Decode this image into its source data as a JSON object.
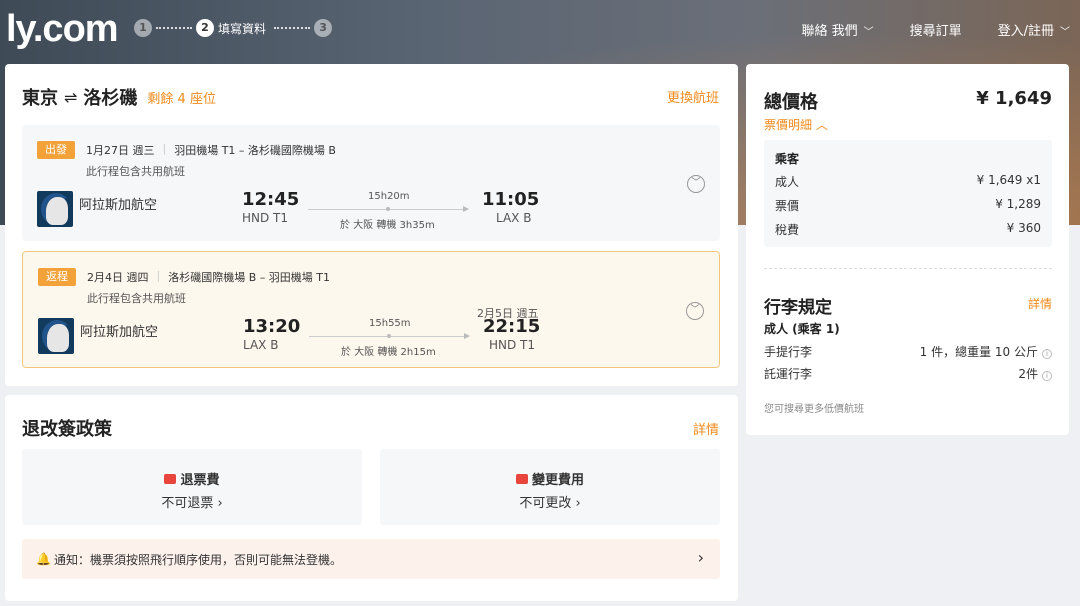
{
  "header": {
    "logo": "ly.com",
    "steps": [
      {
        "num": "1",
        "label": ""
      },
      {
        "num": "2",
        "label": "填寫資料"
      },
      {
        "num": "3",
        "label": ""
      }
    ],
    "nav": {
      "contact": "聯絡 我們",
      "search_orders": "搜尋訂單",
      "login": "登入/註冊"
    }
  },
  "flight": {
    "origin": "東京",
    "destination": "洛杉磯",
    "route_arrow": "⇌",
    "seats_left": "剩餘 4 座位",
    "change_flight": "更換航班",
    "segments": [
      {
        "badge": "出發",
        "date": "1月27日 週三",
        "route": "羽田機場 T1 – 洛杉磯國際機場 B",
        "shared": "此行程包含共用航班",
        "airline": "阿拉斯加航空",
        "dep_time": "12:45",
        "dep_code": "HND T1",
        "duration": "15h20m",
        "transfer": "於 大阪 轉機 3h35m",
        "arr_date": "",
        "arr_time": "11:05",
        "arr_code": "LAX B"
      },
      {
        "badge": "返程",
        "date": "2月4日 週四",
        "route": "洛杉磯國際機場 B – 羽田機場 T1",
        "shared": "此行程包含共用航班",
        "airline": "阿拉斯加航空",
        "dep_time": "13:20",
        "dep_code": "LAX B",
        "duration": "15h55m",
        "transfer": "於 大阪 轉機 2h15m",
        "arr_date": "2月5日 週五",
        "arr_time": "22:15",
        "arr_code": "HND T1"
      }
    ]
  },
  "policy": {
    "title": "退改簽政策",
    "detail": "詳情",
    "refund": {
      "title": "退票費",
      "value": "不可退票 ›"
    },
    "change": {
      "title": "變更費用",
      "value": "不可更改 ›"
    },
    "notice": "通知：機票須按照飛行順序使用，否則可能無法登機。",
    "notice_arrow": "›"
  },
  "price": {
    "title": "總價格",
    "total": "¥ 1,649",
    "detail_link": "票價明細 ︿",
    "passenger_title": "乘客",
    "rows": [
      {
        "label": "成人",
        "value": "¥ 1,649 x1"
      },
      {
        "label": "票價",
        "value": "¥ 1,289"
      },
      {
        "label": "稅費",
        "value": "¥ 360"
      }
    ]
  },
  "baggage": {
    "title": "行李規定",
    "detail": "詳情",
    "subtitle": "成人 (乘客 1)",
    "carry_on_label": "手提行李",
    "carry_on_value": "1 件，總重量 10 公斤",
    "checked_label": "託運行李",
    "checked_value": "2件",
    "more_low": "您可搜尋更多低價航班"
  },
  "colors": {
    "accent": "#f08a1c",
    "badge": "#f3a23a",
    "refund_icon": "#e8453c"
  }
}
